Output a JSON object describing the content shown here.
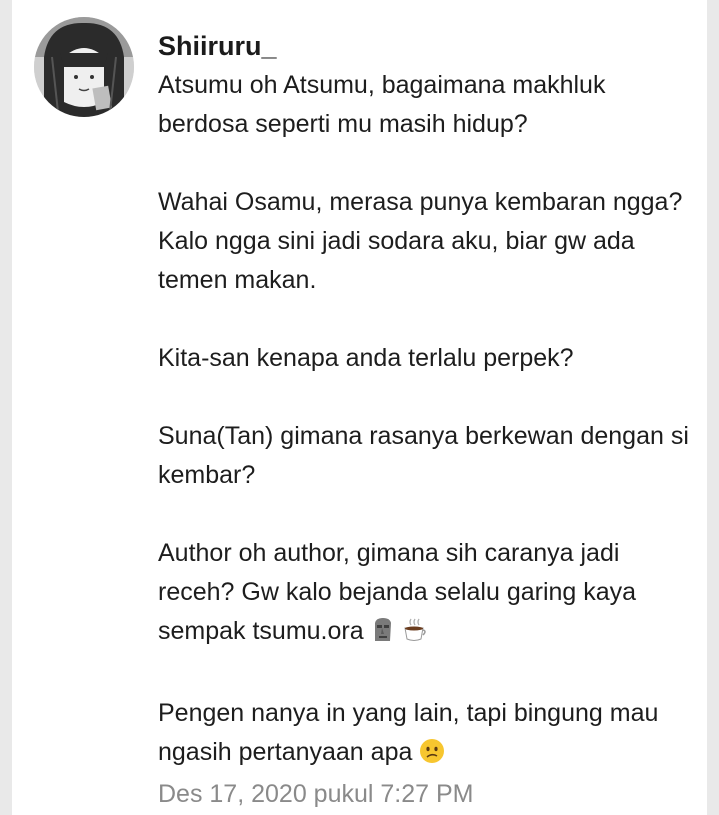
{
  "comment": {
    "username": "Shiiruru_",
    "paragraphs": [
      {
        "text": "Atsumu oh Atsumu, bagaimana makhluk\nberdosa seperti mu masih hidup?"
      },
      {
        "text": "Wahai Osamu, merasa punya kembaran ngga?\nKalo ngga sini jadi sodara aku, biar gw ada\ntemen makan."
      },
      {
        "text": "Kita-san kenapa anda terlalu perpek?"
      },
      {
        "text": "Suna(Tan) gimana rasanya berkewan dengan si\nkembar?"
      },
      {
        "text": "Author oh author, gimana sih caranya jadi\nreceh? Gw kalo bejanda selalu garing kaya\nsempak tsumu.ora "
      },
      {
        "text": "Pengen nanya in yang lain, tapi bingung mau\nngasih pertanyaan apa "
      }
    ],
    "emojis": {
      "moai": "moai-emoji",
      "coffee": "hot-beverage-emoji",
      "confused": "confused-face-emoji"
    },
    "timestamp": "Des 17, 2020 pukul 7:27 PM"
  }
}
